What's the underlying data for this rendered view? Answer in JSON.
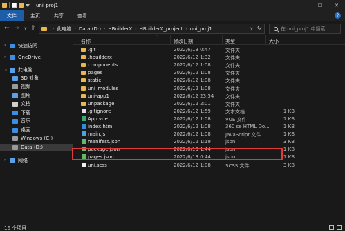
{
  "window": {
    "title": "uni_proj1",
    "controls": {
      "minimize": "—",
      "maximize": "☐",
      "close": "✕"
    }
  },
  "ribbon": {
    "tabs": [
      "文件",
      "主页",
      "共享",
      "查看"
    ],
    "help": "?"
  },
  "address": {
    "crumbs": [
      "此电脑",
      "Data (D:)",
      "HBuilderX",
      "HBuilderX_project",
      "uni_proj1"
    ],
    "search_placeholder": "在 uni_proj1 中搜索"
  },
  "sidebar": {
    "items": [
      {
        "label": "快速访问",
        "icon": "star-icon",
        "color": "#3a8ee6"
      },
      {
        "label": "OneDrive",
        "icon": "cloud-icon",
        "color": "#3a8ee6"
      },
      {
        "label": "此电脑",
        "icon": "computer-icon",
        "color": "#5aa0e8"
      },
      {
        "label": "3D 对象",
        "icon": "cube-icon",
        "color": "#5aa0e8"
      },
      {
        "label": "视频",
        "icon": "video-icon",
        "color": "#9a9a9a"
      },
      {
        "label": "图片",
        "icon": "picture-icon",
        "color": "#5aa0e8"
      },
      {
        "label": "文档",
        "icon": "document-icon",
        "color": "#cfcfcf"
      },
      {
        "label": "下载",
        "icon": "download-icon",
        "color": "#3a8ee6"
      },
      {
        "label": "音乐",
        "icon": "music-icon",
        "color": "#3a8ee6"
      },
      {
        "label": "桌面",
        "icon": "desktop-icon",
        "color": "#3a8ee6"
      },
      {
        "label": "Windows (C:)",
        "icon": "drive-icon",
        "color": "#9a9a9a"
      },
      {
        "label": "Data (D:)",
        "icon": "drive-icon",
        "color": "#9a9a9a"
      },
      {
        "label": "网络",
        "icon": "network-icon",
        "color": "#5aa0e8"
      }
    ]
  },
  "columns": {
    "name": "名称",
    "date": "修改日期",
    "type": "类型",
    "size": "大小"
  },
  "files": [
    {
      "name": ".git",
      "date": "2022/6/13 0:47",
      "type": "文件夹",
      "size": "",
      "kind": "folder"
    },
    {
      "name": ".hbuilderx",
      "date": "2022/6/12 1:32",
      "type": "文件夹",
      "size": "",
      "kind": "folder"
    },
    {
      "name": "components",
      "date": "2022/6/12 1:08",
      "type": "文件夹",
      "size": "",
      "kind": "folder"
    },
    {
      "name": "pages",
      "date": "2022/6/12 1:08",
      "type": "文件夹",
      "size": "",
      "kind": "folder"
    },
    {
      "name": "static",
      "date": "2022/6/12 1:08",
      "type": "文件夹",
      "size": "",
      "kind": "folder"
    },
    {
      "name": "uni_modules",
      "date": "2022/6/12 1:08",
      "type": "文件夹",
      "size": "",
      "kind": "folder"
    },
    {
      "name": "uni-app1",
      "date": "2022/6/12 23:54",
      "type": "文件夹",
      "size": "",
      "kind": "folder"
    },
    {
      "name": "unpackage",
      "date": "2022/6/12 2:01",
      "type": "文件夹",
      "size": "",
      "kind": "folder"
    },
    {
      "name": ".gitignore",
      "date": "2022/6/12 1:59",
      "type": "文本文档",
      "size": "1 KB",
      "kind": "file"
    },
    {
      "name": "App.vue",
      "date": "2022/6/12 1:08",
      "type": "VUE 文件",
      "size": "1 KB",
      "kind": "vue"
    },
    {
      "name": "index.html",
      "date": "2022/6/12 1:08",
      "type": "360 se HTML Do...",
      "size": "1 KB",
      "kind": "html"
    },
    {
      "name": "main.js",
      "date": "2022/6/12 1:08",
      "type": "JavaScript 文件",
      "size": "1 KB",
      "kind": "js"
    },
    {
      "name": "manifest.json",
      "date": "2022/6/12 1:19",
      "type": "json",
      "size": "3 KB",
      "kind": "json"
    },
    {
      "name": "package.json",
      "date": "2022/6/13 1:44",
      "type": "json",
      "size": "1 KB",
      "kind": "json"
    },
    {
      "name": "pages.json",
      "date": "2022/6/13 0:44",
      "type": "json",
      "size": "1 KB",
      "kind": "json"
    },
    {
      "name": "uni.scss",
      "date": "2022/6/12 1:08",
      "type": "SCSS 文件",
      "size": "3 KB",
      "kind": "scss"
    }
  ],
  "status": {
    "count": "16 个项目"
  }
}
